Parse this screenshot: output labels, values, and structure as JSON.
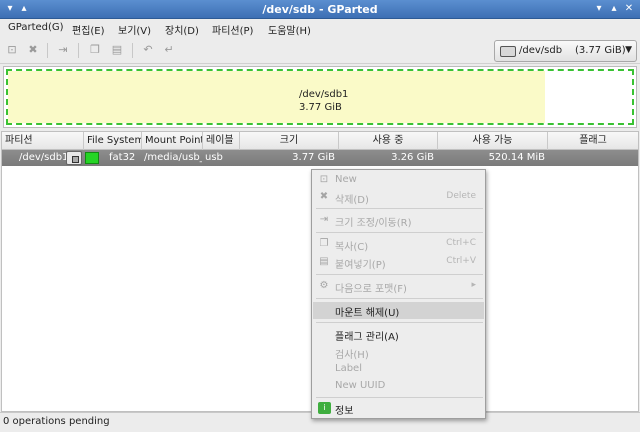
{
  "window": {
    "title": "/dev/sdb - GParted"
  },
  "menubar": [
    "GParted(G)",
    "편집(E)",
    "보기(V)",
    "장치(D)",
    "파티션(P)",
    "도움말(H)"
  ],
  "toolbar": {
    "icons": [
      "new-partition-icon",
      "delete-icon",
      "resize-move-icon",
      "copy-icon",
      "paste-icon",
      "undo-icon",
      "apply-icon"
    ],
    "device_selector": {
      "name": "/dev/sdb",
      "size": "(3.77 GiB)"
    }
  },
  "disk_graphic": {
    "partition": "/dev/sdb1",
    "size": "3.77 GiB",
    "used_fraction": 0.86
  },
  "table": {
    "headers": [
      "파티션",
      "File System",
      "Mount Point",
      "레이블",
      "크기",
      "사용 중",
      "사용 가능",
      "플래그"
    ],
    "rows": [
      {
        "partition": "/dev/sdb1",
        "filesystem": "fat32",
        "mount_point": "/media/usb_",
        "label": "usb",
        "size": "3.77 GiB",
        "used": "3.26 GiB",
        "unused": "520.14 MiB",
        "flags": ""
      }
    ]
  },
  "status": {
    "text": "0 operations pending"
  },
  "context_menu": {
    "new": "New",
    "delete": "삭제(D)",
    "delete_accel": "Delete",
    "resize": "크기 조정/이동(R)",
    "copy": "복사(C)",
    "copy_accel": "Ctrl+C",
    "paste": "붙여넣기(P)",
    "paste_accel": "Ctrl+V",
    "format": "다음으로 포맷(F)",
    "unmount": "마운트 해제(U)",
    "manage_flags": "플래그 관리(A)",
    "check": "검사(H)",
    "label": "Label",
    "new_uuid": "New UUID",
    "info": "정보"
  },
  "colors": {
    "titlebar": "#4a7fc4",
    "partition_border": "#39c232",
    "used_fill": "#fafac8",
    "fat32": "#25d425",
    "selected_row": "#858585"
  }
}
